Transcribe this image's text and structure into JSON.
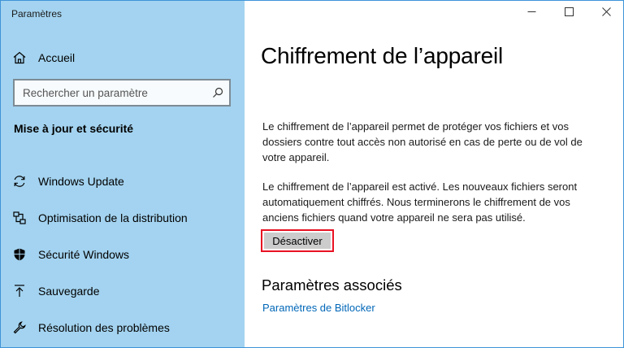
{
  "window": {
    "title": "Paramètres",
    "controls": {
      "minimize_icon": "minimize-icon",
      "maximize_icon": "maximize-icon",
      "close_icon": "close-icon"
    }
  },
  "sidebar": {
    "home": {
      "label": "Accueil",
      "icon": "home-icon"
    },
    "search": {
      "placeholder": "Rechercher un paramètre",
      "value": "",
      "icon": "search-icon"
    },
    "section_title": "Mise à jour et sécurité",
    "items": [
      {
        "label": "Windows Update",
        "icon": "sync-icon"
      },
      {
        "label": "Optimisation de la distribution",
        "icon": "distribution-icon"
      },
      {
        "label": "Sécurité Windows",
        "icon": "shield-icon"
      },
      {
        "label": "Sauvegarde",
        "icon": "backup-icon"
      },
      {
        "label": "Résolution des problèmes",
        "icon": "wrench-icon"
      }
    ]
  },
  "main": {
    "title": "Chiffrement de l’appareil",
    "paragraph1": "Le chiffrement de l’appareil permet de protéger vos fichiers et vos dossiers contre tout accès non autorisé en cas de perte ou de vol de votre appareil.",
    "paragraph2": "Le chiffrement de l’appareil est activé. Les nouveaux fichiers seront automatiquement chiffrés. Nous terminerons le chiffrement de vos anciens fichiers quand votre appareil ne sera pas utilisé.",
    "disable_button": "Désactiver",
    "related": {
      "title": "Paramètres associés",
      "link": "Paramètres de Bitlocker"
    }
  },
  "colors": {
    "sidebar_bg": "#a3d3f0",
    "link": "#0067b8",
    "highlight_border": "#e81123",
    "button_bg": "#cccccc"
  }
}
